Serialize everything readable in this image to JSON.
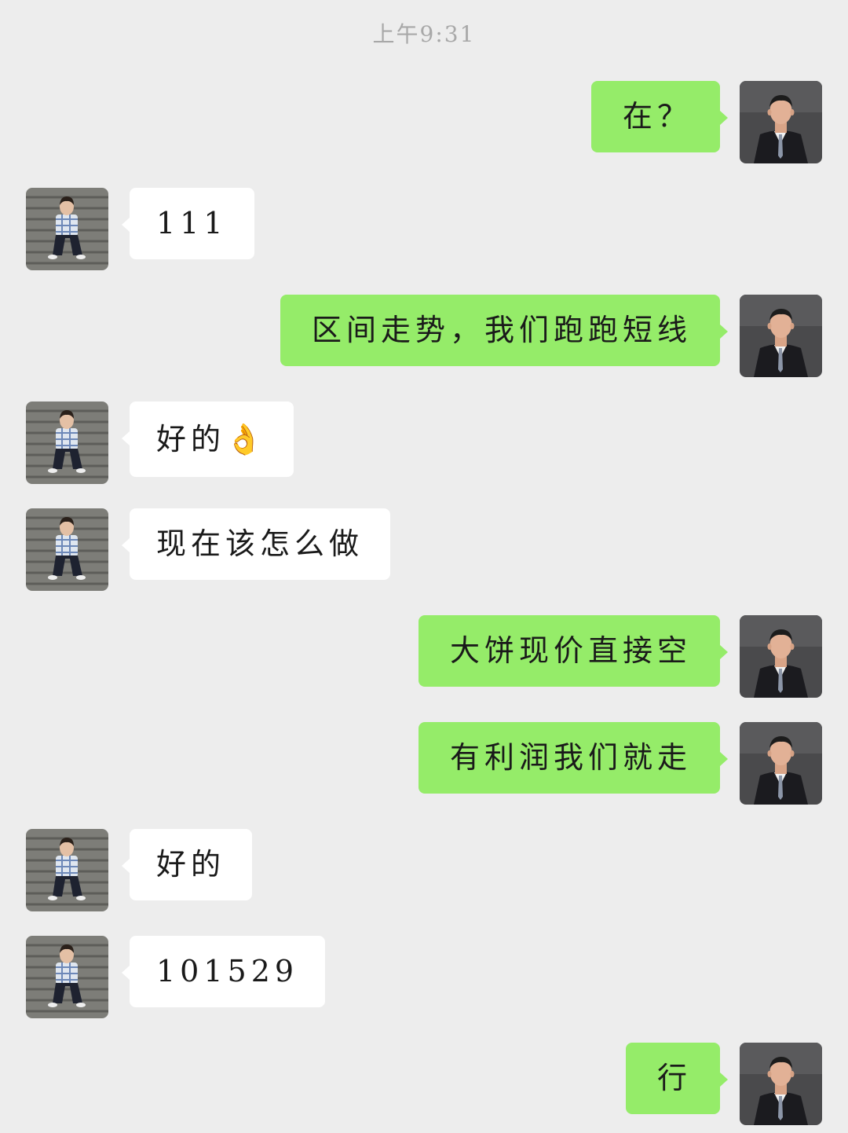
{
  "chat": {
    "timestamp": "上午9:31",
    "messages": [
      {
        "from": "me",
        "text": "在？"
      },
      {
        "from": "other",
        "text": "111"
      },
      {
        "from": "me",
        "text": "区间走势，我们跑跑短线"
      },
      {
        "from": "other",
        "text": "好的👌"
      },
      {
        "from": "other",
        "text": "现在该怎么做"
      },
      {
        "from": "me",
        "text": "大饼现价直接空"
      },
      {
        "from": "me",
        "text": "有利润我们就走"
      },
      {
        "from": "other",
        "text": "好的"
      },
      {
        "from": "other",
        "text": "101529"
      },
      {
        "from": "me",
        "text": "行"
      }
    ]
  },
  "colors": {
    "background": "#ededed",
    "my_bubble": "#95ec69",
    "their_bubble": "#ffffff",
    "timestamp_text": "#a8a8a8"
  },
  "icons": {
    "my_avatar": "man-in-suit-avatar",
    "their_avatar": "person-on-stairs-avatar"
  }
}
